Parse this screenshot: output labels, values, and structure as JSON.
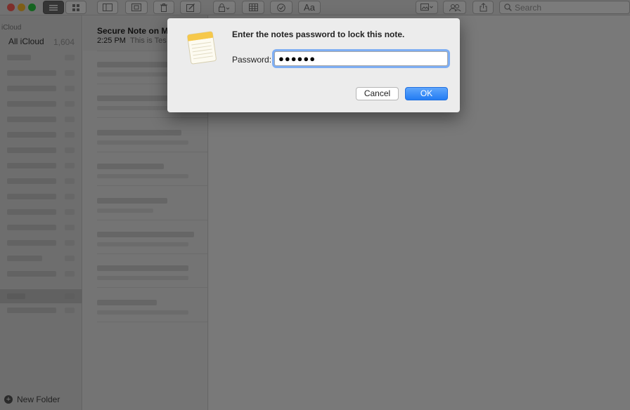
{
  "toolbar": {
    "search_placeholder": "Search",
    "text_format_label": "Aa"
  },
  "sidebar": {
    "section_label": "iCloud",
    "all_label": "All iCloud",
    "all_count": "1,604",
    "new_folder_label": "New Folder"
  },
  "notes_list": {
    "first_note": {
      "title": "Secure Note on M",
      "time": "2:25 PM",
      "preview": "This is Tes"
    }
  },
  "dialog": {
    "title": "Enter the notes password to lock this note.",
    "password_label": "Password:",
    "password_value": "●●●●●●",
    "cancel_label": "Cancel",
    "ok_label": "OK"
  },
  "colors": {
    "accent": "#237cf3",
    "focus_ring": "#7eaef3",
    "icon_yellow": "#f6c84a"
  }
}
